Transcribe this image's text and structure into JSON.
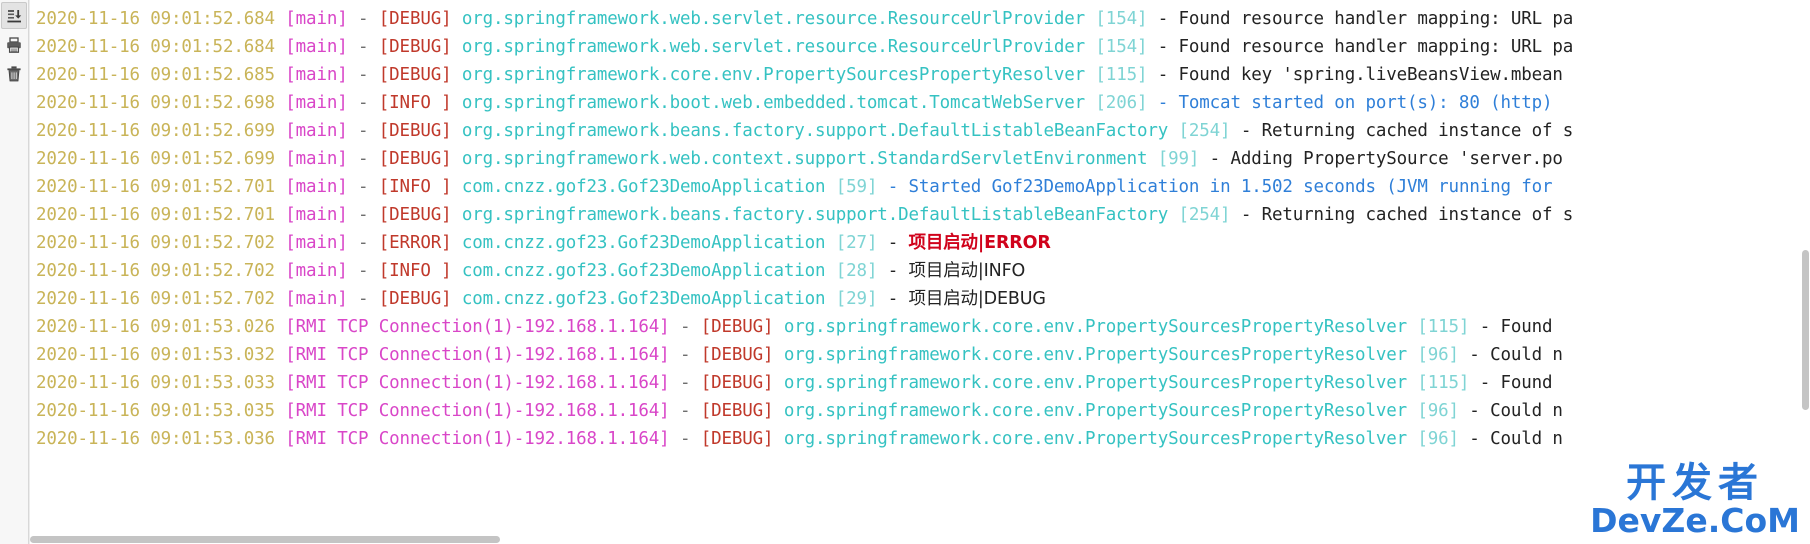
{
  "toolbar": {
    "items": [
      {
        "name": "download-icon",
        "label": "Download log",
        "active": true
      },
      {
        "name": "print-icon",
        "label": "Print log",
        "active": false
      },
      {
        "name": "trash-icon",
        "label": "Clear log",
        "active": false
      }
    ]
  },
  "watermark": {
    "cn": "开发者",
    "en": "DevZe.CoM",
    "color": "#1f6fd4"
  },
  "colors": {
    "timestamp": "#c9b458",
    "thread": "#d946c8",
    "level": "#c0392b",
    "logger": "#35c2c2",
    "lineno": "#7fd4d4",
    "message": "#232323",
    "info_highlight": "#2f7fd8",
    "cn_error": "#d0021b",
    "background": "#ffffff",
    "toolbar_bg": "#f7f7f7"
  },
  "log": {
    "lines": [
      {
        "ts": "2020-11-16 09:01:52.684",
        "thread": "[main]",
        "sep": " - ",
        "level": "[DEBUG]",
        "level_class": "lvl-debug",
        "logger": "org.springframework.web.servlet.resource.ResourceUrlProvider",
        "lineno": "[154]",
        "msg": " - Found resource handler mapping: URL pa",
        "msg_class": "msg"
      },
      {
        "ts": "2020-11-16 09:01:52.684",
        "thread": "[main]",
        "sep": " - ",
        "level": "[DEBUG]",
        "level_class": "lvl-debug",
        "logger": "org.springframework.web.servlet.resource.ResourceUrlProvider",
        "lineno": "[154]",
        "msg": " - Found resource handler mapping: URL pa",
        "msg_class": "msg"
      },
      {
        "ts": "2020-11-16 09:01:52.685",
        "thread": "[main]",
        "sep": " - ",
        "level": "[DEBUG]",
        "level_class": "lvl-debug",
        "logger": "org.springframework.core.env.PropertySourcesPropertyResolver",
        "lineno": "[115]",
        "msg": " - Found key 'spring.liveBeansView.mbean",
        "msg_class": "msg"
      },
      {
        "ts": "2020-11-16 09:01:52.698",
        "thread": "[main]",
        "sep": " - ",
        "level": "[INFO ]",
        "level_class": "lvl-info",
        "logger": "org.springframework.boot.web.embedded.tomcat.TomcatWebServer",
        "lineno": "[206]",
        "msg": " - Tomcat started on port(s): 80 (http) ",
        "msg_class": "msg-info-hl"
      },
      {
        "ts": "2020-11-16 09:01:52.699",
        "thread": "[main]",
        "sep": " - ",
        "level": "[DEBUG]",
        "level_class": "lvl-debug",
        "logger": "org.springframework.beans.factory.support.DefaultListableBeanFactory",
        "lineno": "[254]",
        "msg": " - Returning cached instance of s",
        "msg_class": "msg"
      },
      {
        "ts": "2020-11-16 09:01:52.699",
        "thread": "[main]",
        "sep": " - ",
        "level": "[DEBUG]",
        "level_class": "lvl-debug",
        "logger": "org.springframework.web.context.support.StandardServletEnvironment",
        "lineno": "[99]",
        "msg": " - Adding PropertySource 'server.po",
        "msg_class": "msg"
      },
      {
        "ts": "2020-11-16 09:01:52.701",
        "thread": "[main]",
        "sep": " - ",
        "level": "[INFO ]",
        "level_class": "lvl-info",
        "logger": "com.cnzz.gof23.Gof23DemoApplication",
        "lineno": "[59]",
        "msg": " - Started Gof23DemoApplication in 1.502 seconds (JVM running for ",
        "msg_class": "msg-info-hl"
      },
      {
        "ts": "2020-11-16 09:01:52.701",
        "thread": "[main]",
        "sep": " - ",
        "level": "[DEBUG]",
        "level_class": "lvl-debug",
        "logger": "org.springframework.beans.factory.support.DefaultListableBeanFactory",
        "lineno": "[254]",
        "msg": " - Returning cached instance of s",
        "msg_class": "msg"
      },
      {
        "ts": "2020-11-16 09:01:52.702",
        "thread": "[main]",
        "sep": " - ",
        "level": "[ERROR]",
        "level_class": "lvl-error",
        "logger": "com.cnzz.gof23.Gof23DemoApplication",
        "lineno": "[27]",
        "msg": " - ",
        "msg_class": "msg",
        "cn": "项目启动|ERROR",
        "cn_class": "cn-error"
      },
      {
        "ts": "2020-11-16 09:01:52.702",
        "thread": "[main]",
        "sep": " - ",
        "level": "[INFO ]",
        "level_class": "lvl-info",
        "logger": "com.cnzz.gof23.Gof23DemoApplication",
        "lineno": "[28]",
        "msg": " - ",
        "msg_class": "msg",
        "cn": "项目启动|INFO",
        "cn_class": "cn-info"
      },
      {
        "ts": "2020-11-16 09:01:52.702",
        "thread": "[main]",
        "sep": " - ",
        "level": "[DEBUG]",
        "level_class": "lvl-debug",
        "logger": "com.cnzz.gof23.Gof23DemoApplication",
        "lineno": "[29]",
        "msg": " - ",
        "msg_class": "msg",
        "cn": "项目启动|DEBUG",
        "cn_class": "cn-debug"
      },
      {
        "ts": "2020-11-16 09:01:53.026",
        "thread": "[RMI TCP Connection(1)-192.168.1.164]",
        "sep": " - ",
        "level": "[DEBUG]",
        "level_class": "lvl-debug",
        "logger": "org.springframework.core.env.PropertySourcesPropertyResolver",
        "lineno": "[115]",
        "msg": " - Found ",
        "msg_class": "msg"
      },
      {
        "ts": "2020-11-16 09:01:53.032",
        "thread": "[RMI TCP Connection(1)-192.168.1.164]",
        "sep": " - ",
        "level": "[DEBUG]",
        "level_class": "lvl-debug",
        "logger": "org.springframework.core.env.PropertySourcesPropertyResolver",
        "lineno": "[96]",
        "msg": " - Could n",
        "msg_class": "msg"
      },
      {
        "ts": "2020-11-16 09:01:53.033",
        "thread": "[RMI TCP Connection(1)-192.168.1.164]",
        "sep": " - ",
        "level": "[DEBUG]",
        "level_class": "lvl-debug",
        "logger": "org.springframework.core.env.PropertySourcesPropertyResolver",
        "lineno": "[115]",
        "msg": " - Found ",
        "msg_class": "msg"
      },
      {
        "ts": "2020-11-16 09:01:53.035",
        "thread": "[RMI TCP Connection(1)-192.168.1.164]",
        "sep": " - ",
        "level": "[DEBUG]",
        "level_class": "lvl-debug",
        "logger": "org.springframework.core.env.PropertySourcesPropertyResolver",
        "lineno": "[96]",
        "msg": " - Could n",
        "msg_class": "msg"
      },
      {
        "ts": "2020-11-16 09:01:53.036",
        "thread": "[RMI TCP Connection(1)-192.168.1.164]",
        "sep": " - ",
        "level": "[DEBUG]",
        "level_class": "lvl-debug",
        "logger": "org.springframework.core.env.PropertySourcesPropertyResolver",
        "lineno": "[96]",
        "msg": " - Could n",
        "msg_class": "msg"
      }
    ]
  }
}
